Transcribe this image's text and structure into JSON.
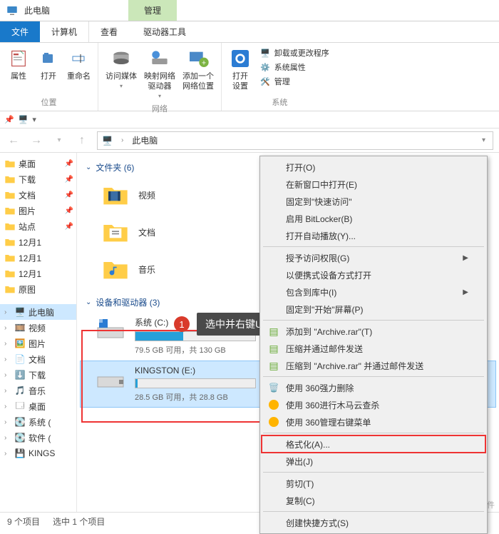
{
  "title": "此电脑",
  "titletab": "管理",
  "tabs": {
    "file": "文件",
    "computer": "计算机",
    "view": "查看",
    "drivetools": "驱动器工具"
  },
  "ribbon": {
    "group_location": "位置",
    "group_network": "网络",
    "group_system": "系统",
    "properties": "属性",
    "open": "打开",
    "rename": "重命名",
    "access_media": "访问媒体",
    "map_network": "映射网络\n驱动器",
    "add_location": "添加一个\n网络位置",
    "open_settings": "打开\n设置",
    "uninstall": "卸载或更改程序",
    "sys_props": "系统属性",
    "manage": "管理"
  },
  "address": {
    "root": "此电脑"
  },
  "tree": [
    {
      "label": "桌面",
      "pin": true
    },
    {
      "label": "下载",
      "pin": true
    },
    {
      "label": "文档",
      "pin": true
    },
    {
      "label": "图片",
      "pin": true
    },
    {
      "label": "站点",
      "pin": true
    },
    {
      "label": "12月1"
    },
    {
      "label": "12月1"
    },
    {
      "label": "12月1"
    },
    {
      "label": "原图"
    }
  ],
  "tree2": [
    {
      "label": "此电脑",
      "sel": true,
      "ico": "pc"
    },
    {
      "label": "视频",
      "ico": "video"
    },
    {
      "label": "图片",
      "ico": "pic"
    },
    {
      "label": "文档",
      "ico": "doc"
    },
    {
      "label": "下载",
      "ico": "dl"
    },
    {
      "label": "音乐",
      "ico": "music"
    },
    {
      "label": "桌面",
      "ico": "desktop"
    },
    {
      "label": "系统 (",
      "ico": "drive"
    },
    {
      "label": "软件 (",
      "ico": "drive"
    },
    {
      "label": "KINGS",
      "ico": "usb"
    }
  ],
  "section_folders": "文件夹 (6)",
  "section_drives": "设备和驱动器 (3)",
  "folders": [
    {
      "name": "视频",
      "kind": "video"
    },
    {
      "name": "文档",
      "kind": "doc"
    },
    {
      "name": "音乐",
      "kind": "music"
    }
  ],
  "drives": [
    {
      "name": "系统 (C:)",
      "free": "79.5 GB 可用，共 130 GB",
      "fill": 40
    },
    {
      "name": "KINGSTON (E:)",
      "free": "28.5 GB 可用，共 28.8 GB",
      "fill": 2,
      "sel": true
    }
  ],
  "callout": {
    "num": "1",
    "text": "选中并右键U盘图标，点击“格式化”"
  },
  "context_menu": [
    {
      "label": "打开(O)"
    },
    {
      "label": "在新窗口中打开(E)"
    },
    {
      "label": "固定到\"快速访问\""
    },
    {
      "label": "启用 BitLocker(B)"
    },
    {
      "label": "打开自动播放(Y)..."
    },
    {
      "sep": true
    },
    {
      "label": "授予访问权限(G)",
      "sub": true
    },
    {
      "label": "以便携式设备方式打开"
    },
    {
      "label": "包含到库中(I)",
      "sub": true
    },
    {
      "label": "固定到\"开始\"屏幕(P)"
    },
    {
      "sep": true
    },
    {
      "label": "添加到 \"Archive.rar\"(T)",
      "ico": "rar"
    },
    {
      "label": "压缩并通过邮件发送",
      "ico": "rar"
    },
    {
      "label": "压缩到 \"Archive.rar\" 并通过邮件发送",
      "ico": "rar"
    },
    {
      "sep": true
    },
    {
      "label": "使用 360强力删除",
      "ico": "360d"
    },
    {
      "label": "使用 360进行木马云查杀",
      "ico": "360y"
    },
    {
      "label": "使用 360管理右键菜单",
      "ico": "360g"
    },
    {
      "sep": true
    },
    {
      "label": "格式化(A)...",
      "hl": true
    },
    {
      "label": "弹出(J)"
    },
    {
      "sep": true
    },
    {
      "label": "剪切(T)"
    },
    {
      "label": "复制(C)"
    },
    {
      "sep": true
    },
    {
      "label": "创建快捷方式(S)"
    }
  ],
  "status": {
    "items": "9 个项目",
    "selected": "选中 1 个项目"
  },
  "watermark": "头条 @数据蛙软件"
}
